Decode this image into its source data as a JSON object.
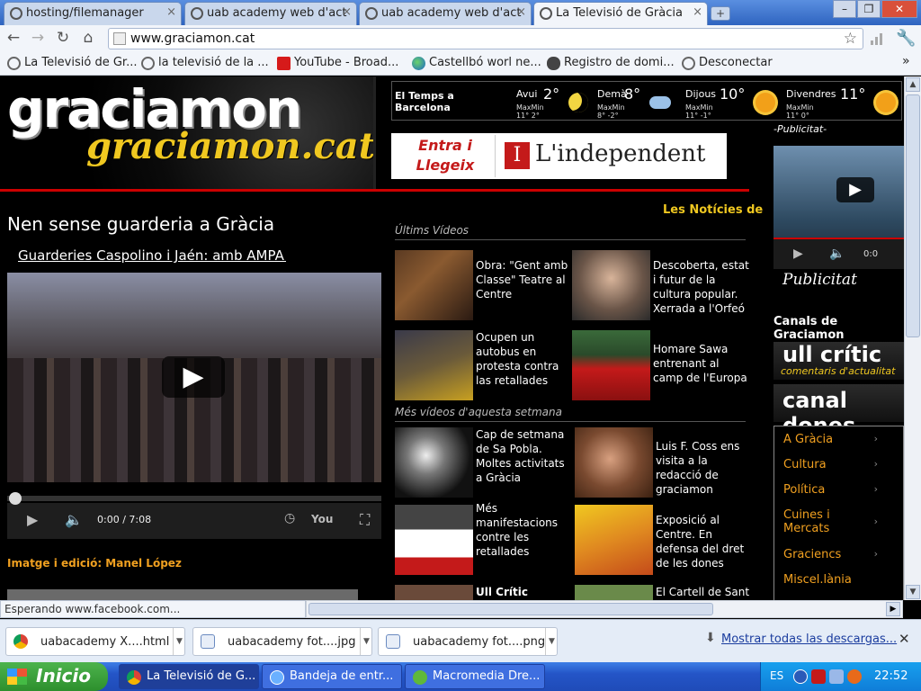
{
  "browser": {
    "tabs": [
      {
        "label": "hosting/filemanager",
        "active": false
      },
      {
        "label": "uab academy web d'act",
        "active": false
      },
      {
        "label": "uab academy web d'act",
        "active": false
      },
      {
        "label": "La Televisió de Gràcia",
        "active": true
      }
    ],
    "tab_close": "×",
    "new_tab": "+",
    "window_buttons": [
      "–",
      "❐",
      "✕"
    ],
    "nav": {
      "back": "←",
      "forward": "→",
      "reload": "↻",
      "home": "⌂"
    },
    "url": "www.graciamon.cat",
    "bookmarks": [
      {
        "label": "La Televisió de Gr...",
        "icon": "globe-gray"
      },
      {
        "label": "la televisió de la ...",
        "icon": "globe-gray"
      },
      {
        "label": "YouTube - Broad...",
        "icon": "youtube"
      },
      {
        "label": "Castellbó worl ne...",
        "icon": "globe"
      },
      {
        "label": "Registro de domi...",
        "icon": "cloud"
      },
      {
        "label": "Desconectar",
        "icon": "globe-gray"
      }
    ],
    "bookmarks_more": "»",
    "status_text": "Esperando www.facebook.com..."
  },
  "site": {
    "logo_top": "graciamon",
    "logo_bottom": "graciamon.cat",
    "weather": {
      "title_line1": "El Temps a",
      "title_line2": "Barcelona",
      "days": [
        {
          "name": "Avui",
          "temp": "2°",
          "maxmin_label": "MaxMin",
          "maxmin": "11° 2°",
          "icon": "moon"
        },
        {
          "name": "Demà",
          "temp": "8°",
          "maxmin_label": "MaxMin",
          "maxmin": "8° -2°",
          "icon": "cloud"
        },
        {
          "name": "Dijous",
          "temp": "10°",
          "maxmin_label": "MaxMin",
          "maxmin": "11° -1°",
          "icon": "sun"
        },
        {
          "name": "Divendres",
          "temp": "11°",
          "maxmin_label": "MaxMin",
          "maxmin": "11° 0°",
          "icon": "sun"
        }
      ]
    },
    "banner": {
      "left_text": "Entra i Llegeix",
      "right_text": "L'independent",
      "logo_mark": "I"
    },
    "publicitat_label": "-Publicitat-",
    "publicitat_caption": "Publicitat",
    "ad_video_time": "0:0",
    "canals_title": "Canals de Graciamon",
    "canal_banners": [
      {
        "title": "ull crític",
        "subtitle": "comentaris d'actualitat"
      },
      {
        "title": "canal dones",
        "subtitle": ""
      }
    ],
    "canal_menu": [
      "A Gràcia",
      "Cultura",
      "Política",
      "Cuines i Mercats",
      "Graciencs",
      "Miscel.lània"
    ],
    "menu_chevron": "›",
    "story": {
      "title": "Nen sense guarderia a Gràcia",
      "subtitle": "Guarderies Caspolino i Jaén: amb AMPA p",
      "time": "0:00 / 7:08",
      "credit": "Imatge i edició: Manel López"
    },
    "les_noticies": "Les Notícies de",
    "ultims_videos_header": "Últims Vídeos",
    "ultims_videos": [
      {
        "text": "Obra: \"Gent amb Classe\" Teatre al Centre"
      },
      {
        "text": "Descoberta, estat i futur de la cultura popular. Xerrada a l'Orfeó"
      },
      {
        "text": "Ocupen un autobus en protesta contra las retallades"
      },
      {
        "text": "Homare Sawa entrenant al camp de l'Europa"
      }
    ],
    "mes_videos_header": "Més vídeos d'aquesta setmana",
    "mes_videos": [
      {
        "text": "Cap de setmana de Sa Pobla. Moltes activitats a Gràcia"
      },
      {
        "text": "Luis F. Coss ens visita a la redacció de graciamon"
      },
      {
        "text": "Més manifestacions contre les retallades"
      },
      {
        "text": "Exposició al Centre. En defensa del dret de les dones"
      },
      {
        "text": "Ull Crític"
      },
      {
        "text": "El Cartell de Sant"
      }
    ]
  },
  "downloads": {
    "items": [
      {
        "name": "uabacademy X....html",
        "icon": "chrome"
      },
      {
        "name": "uabacademy fot....jpg",
        "icon": "image"
      },
      {
        "name": "uabacademy fot....png",
        "icon": "image"
      }
    ],
    "show_all": "Mostrar todas las descargas...",
    "close": "✕"
  },
  "taskbar": {
    "start_label": "Inicio",
    "tasks": [
      {
        "label": "La Televisió de G...",
        "active": true
      },
      {
        "label": "Bandeja de entr...",
        "active": false
      },
      {
        "label": "Macromedia Dre...",
        "active": false
      }
    ],
    "lang": "ES",
    "clock": "22:52"
  }
}
